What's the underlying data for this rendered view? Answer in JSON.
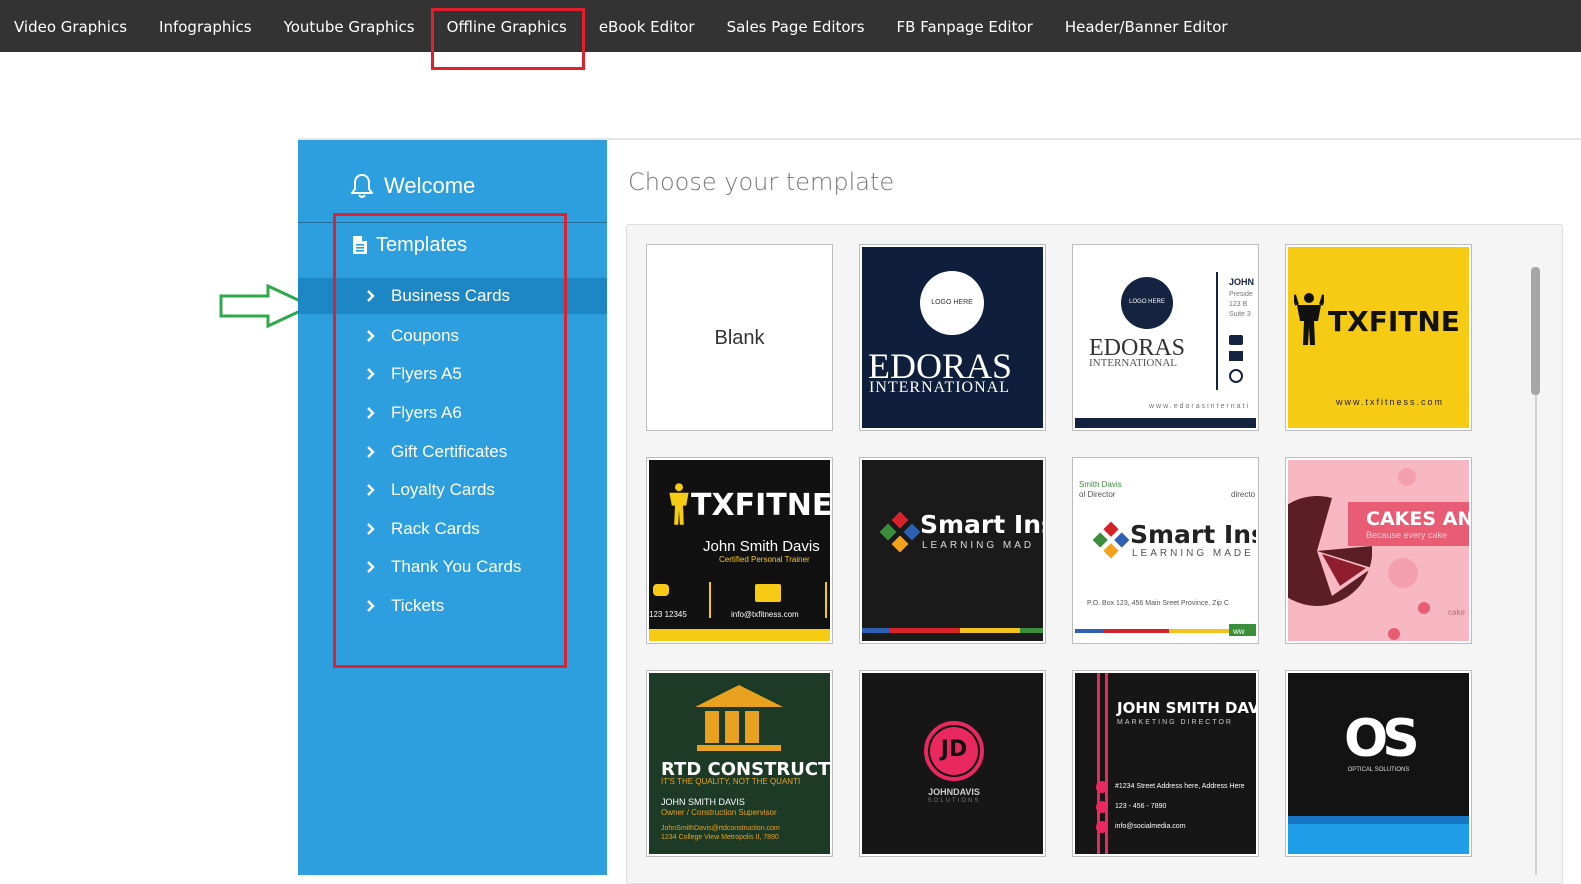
{
  "topnav": {
    "items": [
      "Video Graphics",
      "Infographics",
      "Youtube Graphics",
      "Offline Graphics",
      "eBook Editor",
      "Sales Page Editors",
      "FB Fanpage Editor",
      "Header/Banner Editor"
    ]
  },
  "sidebar": {
    "welcome": "Welcome",
    "templates": "Templates",
    "items": [
      "Business Cards",
      "Coupons",
      "Flyers A5",
      "Flyers A6",
      "Gift Certificates",
      "Loyalty Cards",
      "Rack Cards",
      "Thank You Cards",
      "Tickets"
    ],
    "active_item": "Business Cards"
  },
  "content": {
    "title": "Choose your template"
  },
  "templates": {
    "blank": "Blank",
    "edoras": {
      "logo": "LOGO HERE",
      "name": "EDORAS",
      "sub": "INTERNATIONAL",
      "web": "www.edorasinternati",
      "person": "JOHN",
      "role": "Preside",
      "addr1": "123 B",
      "addr2": "Suite 3"
    },
    "txfitness": {
      "brand": "TXFITNE",
      "web": "www.txfitness.com",
      "person": "John Smith Davis",
      "role": "Certified Personal Trainer",
      "phone": "123 12345",
      "email": "info@txfitness.com"
    },
    "smart": {
      "brand": "Smart Inst",
      "brand2": "Smart Insti",
      "sub": "LEARNING MAD",
      "sub2": "LEARNING MADE",
      "person": "Smith Davis",
      "role": "ol Director",
      "direct": "directo",
      "addr": "P.O. Box 123, 456 Main Sreet Province, Zip C",
      "web": "ww"
    },
    "cakes": {
      "brand": "CAKES AN",
      "tag": "Because every cake",
      "small": "cake"
    },
    "rtd": {
      "brand": "RTD CONSTRUCTIC",
      "tag": "IT'S THE QUALITY, NOT THE QUANTI",
      "person": "JOHN SMITH DAVIS",
      "role": "Owner / Construction Supervisor",
      "email": "JohnSmithDavis@rtdconstruction.com",
      "addr": "1234 College View Metropolis II, 7890"
    },
    "jd": {
      "initials": "JD",
      "name": "JOHNDAVIS",
      "sub": "SOLUTIONS"
    },
    "jsd": {
      "name": "JOHN SMITH DAVIS",
      "role": "MARKETING DIRECTOR",
      "addr": "#1234 Street Address here, Address Here",
      "phone": "123 - 456 - 7890",
      "email": "info@socialmedia.com"
    },
    "os": {
      "brand": "OS",
      "sub": "OPTICAL SOLUTIONS"
    }
  },
  "colors": {
    "nav_bg": "#333333",
    "sidebar_bg": "#2e9fde",
    "active_bg": "#1d86c4",
    "annotation_red": "#e0202e",
    "annotation_green": "#2ea84a"
  }
}
